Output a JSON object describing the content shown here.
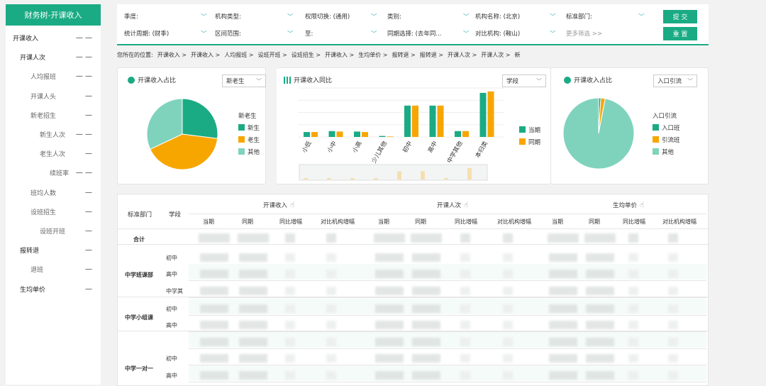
{
  "sidebar": {
    "title": "财务树-开课收入",
    "items": [
      {
        "label": "开课收入",
        "indent": 0,
        "mark": "— —"
      },
      {
        "label": "开课人次",
        "indent": 1,
        "mark": "— —"
      },
      {
        "label": "人均报班",
        "indent": 2,
        "mark": "— —"
      },
      {
        "label": "开课人头",
        "indent": 2,
        "mark": "—"
      },
      {
        "label": "新老招生",
        "indent": 2,
        "mark": "—"
      },
      {
        "label": "新生人次",
        "indent": 3,
        "mark": "— —"
      },
      {
        "label": "老生人次",
        "indent": 3,
        "mark": "—"
      },
      {
        "label": "续班率",
        "indent": 4,
        "mark": "— —"
      },
      {
        "label": "班均人数",
        "indent": 2,
        "mark": "—"
      },
      {
        "label": "设班招生",
        "indent": 2,
        "mark": "—"
      },
      {
        "label": "设班开班",
        "indent": 3,
        "mark": "—"
      },
      {
        "label": "报转退",
        "indent": 1,
        "mark": "—"
      },
      {
        "label": "退班",
        "indent": 2,
        "mark": "—"
      },
      {
        "label": "生均单价",
        "indent": 1,
        "mark": "—"
      }
    ]
  },
  "filters": {
    "row1": [
      {
        "label": "季度:"
      },
      {
        "label": "机构类型:"
      },
      {
        "label": "权限切换: (通用)"
      },
      {
        "label": "类别:"
      },
      {
        "label": "机构名称: (北京)"
      },
      {
        "label": "标准部门:"
      }
    ],
    "row2": [
      {
        "label": "统计周期: (财季)"
      },
      {
        "label": "区间范围:"
      },
      {
        "label": "至:"
      },
      {
        "label": "同期选择: (去年同..."
      },
      {
        "label": "对比机构: (鞍山)"
      },
      {
        "label": "更多筛选 >>"
      }
    ],
    "submit_label": "提 交",
    "reset_label": "重 置"
  },
  "breadcrumb": {
    "prefix": "您所在的位置:",
    "items": [
      "开课收入 >",
      "开课收入 >",
      "人均报班 >",
      "设班开班 >",
      "设班招生 >",
      "开课收入 >",
      "生均单价 >",
      "报转退 >",
      "报转退 >",
      "开课人次 >",
      "开课人次 >",
      "新"
    ]
  },
  "card1": {
    "title": "开课收入占比",
    "select": "新老生",
    "legend_title": "新老生",
    "legend": [
      "新生",
      "老生",
      "其他"
    ]
  },
  "card2": {
    "title": "开课收入同比",
    "select": "学段",
    "legend": [
      "当期",
      "同期"
    ]
  },
  "card3": {
    "title": "开课收入占比",
    "select": "入口引流",
    "legend_title": "入口引流",
    "legend": [
      "入口班",
      "引流班",
      "其他"
    ]
  },
  "colors": {
    "primary": "#1aab84",
    "orange": "#f7a600",
    "light": "#7fd3bd"
  },
  "chart_data": [
    {
      "type": "pie",
      "title": "开课收入占比",
      "labels": [
        "新生",
        "老生",
        "其他"
      ],
      "values": [
        27,
        41,
        32
      ]
    },
    {
      "type": "bar",
      "title": "开课收入同比",
      "categories": [
        "小低",
        "小中",
        "小高",
        "少儿其他",
        "初中",
        "高中",
        "中学其他",
        "本归类"
      ],
      "series": [
        {
          "name": "当期",
          "values": [
            10,
            12,
            11,
            2,
            64,
            64,
            12,
            90
          ]
        },
        {
          "name": "同期",
          "values": [
            10,
            11,
            10,
            1,
            64,
            64,
            12,
            93
          ]
        }
      ],
      "ylim": [
        0,
        100
      ]
    },
    {
      "type": "pie",
      "title": "开课收入占比",
      "labels": [
        "入口班",
        "引流班",
        "其他"
      ],
      "values": [
        1,
        2,
        97
      ]
    }
  ],
  "table": {
    "headers": {
      "dept": "标准部门",
      "stage": "学段",
      "groups": [
        "开课收入",
        "开课人次",
        "生均单价"
      ],
      "sub": [
        "当期",
        "同期",
        "同比增幅",
        "对比机构增幅",
        "当期",
        "同期",
        "同比增幅",
        "对比机构增幅",
        "当期",
        "同期",
        "同比增幅",
        "对比机构增幅"
      ]
    },
    "total_label": "合计",
    "groups": [
      {
        "dept": "中学班课部",
        "stages": [
          "初中",
          "高中",
          "中学其"
        ]
      },
      {
        "dept": "中学小组课",
        "stages": [
          "初中",
          "高中"
        ]
      },
      {
        "dept": "中学一对一",
        "stages": [
          "",
          "初中",
          "高中"
        ]
      }
    ]
  }
}
